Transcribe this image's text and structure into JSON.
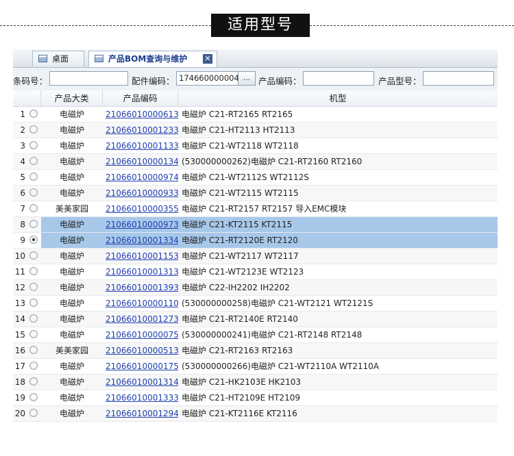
{
  "banner": {
    "title": "适用型号"
  },
  "tabs": [
    {
      "label": "桌面"
    },
    {
      "label": "产品BOM查询与维护"
    }
  ],
  "search": {
    "barcode_label": "条码号：",
    "barcode_value": "",
    "part_code_label": "配件编码：",
    "part_code_value": "174660000004",
    "picker_label": "...",
    "product_code_label": "产品编码：",
    "product_code_value": "",
    "product_model_label": "产品型号：",
    "product_model_value": ""
  },
  "grid": {
    "columns": [
      "产品大类",
      "产品编码",
      "机型"
    ],
    "rows": [
      {
        "num": "1",
        "category": "电磁炉",
        "code": "21066010000613",
        "model": "电磁炉 C21-RT2165 RT2165",
        "selected": false,
        "checked": false
      },
      {
        "num": "2",
        "category": "电磁炉",
        "code": "21066010001233",
        "model": "电磁炉 C21-HT2113 HT2113",
        "selected": false,
        "checked": false
      },
      {
        "num": "3",
        "category": "电磁炉",
        "code": "21066010001133",
        "model": "电磁炉 C21-WT2118 WT2118",
        "selected": false,
        "checked": false
      },
      {
        "num": "4",
        "category": "电磁炉",
        "code": "21066010000134",
        "model": "(530000000262)电磁炉 C21-RT2160 RT2160",
        "selected": false,
        "checked": false
      },
      {
        "num": "5",
        "category": "电磁炉",
        "code": "21066010000974",
        "model": "电磁炉 C21-WT2112S WT2112S",
        "selected": false,
        "checked": false
      },
      {
        "num": "6",
        "category": "电磁炉",
        "code": "21066010000933",
        "model": "电磁炉 C21-WT2115 WT2115",
        "selected": false,
        "checked": false
      },
      {
        "num": "7",
        "category": "美美家园",
        "code": "21066010000355",
        "model": "电磁炉 C21-RT2157 RT2157 导入EMC模块",
        "selected": false,
        "checked": false
      },
      {
        "num": "8",
        "category": "电磁炉",
        "code": "21066010000973",
        "model": "电磁炉 C21-KT2115 KT2115",
        "selected": true,
        "checked": false
      },
      {
        "num": "9",
        "category": "电磁炉",
        "code": "21066010001334",
        "model": "电磁炉 C21-RT2120E RT2120",
        "selected": true,
        "checked": true
      },
      {
        "num": "10",
        "category": "电磁炉",
        "code": "21066010001153",
        "model": "电磁炉 C21-WT2117 WT2117",
        "selected": false,
        "checked": false
      },
      {
        "num": "11",
        "category": "电磁炉",
        "code": "21066010001313",
        "model": "电磁炉 C21-WT2123E WT2123",
        "selected": false,
        "checked": false
      },
      {
        "num": "12",
        "category": "电磁炉",
        "code": "21066010001393",
        "model": "电磁炉 C22-IH2202 IH2202",
        "selected": false,
        "checked": false
      },
      {
        "num": "13",
        "category": "电磁炉",
        "code": "21066010000110",
        "model": "(530000000258)电磁炉 C21-WT2121 WT2121S",
        "selected": false,
        "checked": false
      },
      {
        "num": "14",
        "category": "电磁炉",
        "code": "21066010001273",
        "model": "电磁炉 C21-RT2140E RT2140",
        "selected": false,
        "checked": false
      },
      {
        "num": "15",
        "category": "电磁炉",
        "code": "21066010000075",
        "model": "(530000000241)电磁炉 C21-RT2148 RT2148",
        "selected": false,
        "checked": false
      },
      {
        "num": "16",
        "category": "美美家园",
        "code": "21066010000513",
        "model": "电磁炉 C21-RT2163 RT2163",
        "selected": false,
        "checked": false
      },
      {
        "num": "17",
        "category": "电磁炉",
        "code": "21066010000175",
        "model": "(530000000266)电磁炉 C21-WT2110A WT2110A",
        "selected": false,
        "checked": false
      },
      {
        "num": "18",
        "category": "电磁炉",
        "code": "21066010001314",
        "model": "电磁炉 C21-HK2103E HK2103",
        "selected": false,
        "checked": false
      },
      {
        "num": "19",
        "category": "电磁炉",
        "code": "21066010001333",
        "model": "电磁炉 C21-HT2109E HT2109",
        "selected": false,
        "checked": false
      },
      {
        "num": "20",
        "category": "电磁炉",
        "code": "21066010001294",
        "model": "电磁炉 C21-KT2116E KT2116",
        "selected": false,
        "checked": false
      }
    ]
  }
}
